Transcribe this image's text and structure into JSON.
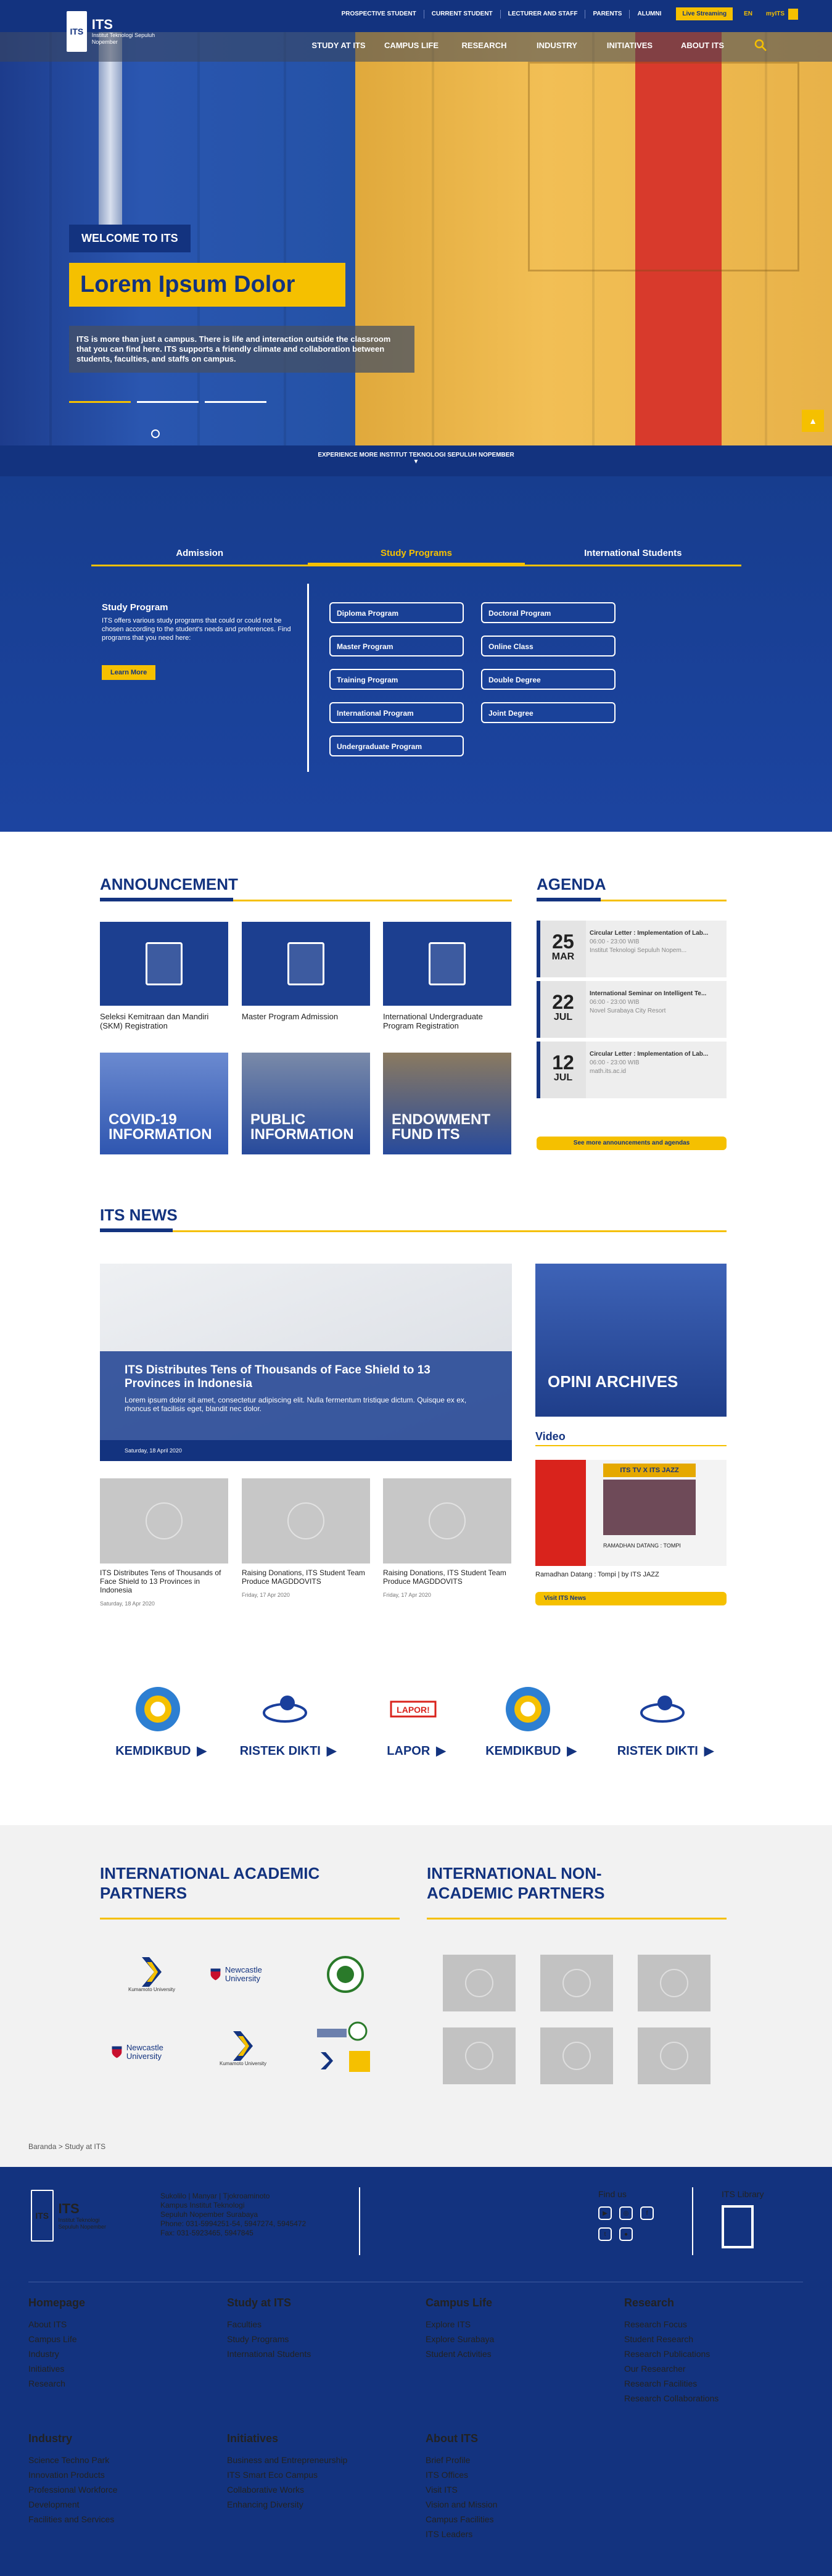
{
  "brand": {
    "logo_name": "ITS",
    "logo_sub": "Institut Teknologi Sepuluh Nopember"
  },
  "topbar": {
    "links": [
      "PROSPECTIVE STUDENT",
      "CURRENT STUDENT",
      "LECTURER AND STAFF",
      "PARENTS",
      "ALUMNI"
    ],
    "live": "Live Streaming",
    "lang": "EN",
    "myits": "myITS"
  },
  "nav": [
    "STUDY AT ITS",
    "CAMPUS LIFE",
    "RESEARCH",
    "INDUSTRY",
    "INITIATIVES",
    "ABOUT ITS"
  ],
  "hero": {
    "welcome": "WELCOME TO ITS",
    "title": "Lorem Ipsum Dolor",
    "desc": "ITS is more than just a campus. There is life and interaction outside the classroom that you can find here. ITS supports a friendly climate and collaboration between students, faculties, and staffs on campus.",
    "experience": "EXPERIENCE MORE INSTITUT TEKNOLOGI SEPULUH NOPEMBER"
  },
  "programs": {
    "tabs": [
      "Admission",
      "Study Programs",
      "International Students"
    ],
    "active_tab": 1,
    "heading": "Study Program",
    "text": "ITS offers various study programs that could or could not be chosen according to the student's needs and preferences. Find programs that you need here:",
    "learn_more": "Learn More",
    "buttons_left": [
      "Diploma Program",
      "Master Program",
      "Training Program",
      "International Program",
      "Undergraduate Program"
    ],
    "buttons_right": [
      "Doctoral Program",
      "Online Class",
      "Double Degree",
      "Joint Degree"
    ]
  },
  "announcement": {
    "title": "ANNOUNCEMENT",
    "items": [
      "Seleksi Kemitraan dan Mandiri (SKM) Registration",
      "Master Program Admission",
      "International Undergraduate Program Registration"
    ],
    "info": [
      "COVID-19 INFORMATION",
      "PUBLIC INFORMATION",
      "ENDOWMENT FUND ITS"
    ]
  },
  "agenda": {
    "title": "AGENDA",
    "items": [
      {
        "day": "25",
        "month": "MAR",
        "title": "Circular Letter : Implementation of Lab...",
        "time": "06:00 - 23:00 WIB",
        "place": "Institut Teknologi Sepuluh Nopem..."
      },
      {
        "day": "22",
        "month": "JUL",
        "title": "International Seminar on Intelligent Te...",
        "time": "06:00 - 23:00 WIB",
        "place": "Novel Surabaya City Resort"
      },
      {
        "day": "12",
        "month": "JUL",
        "title": "Circular Letter : Implementation of Lab...",
        "time": "06:00 - 23:00 WIB",
        "place": "math.its.ac.id"
      }
    ],
    "more": "See more announcements and agendas"
  },
  "news": {
    "title": "ITS NEWS",
    "main_title": "ITS Distributes Tens of Thousands of Face Shield to 13 Provinces in Indonesia",
    "main_text": "Lorem ipsum dolor sit amet, consectetur adipiscing elit. Nulla fermentum tristique dictum. Quisque ex ex, rhoncus et facilisis eget, blandit nec dolor.",
    "main_date": "Saturday, 18 April 2020",
    "items": [
      {
        "title": "ITS Distributes Tens of Thousands of Face Shield to 13 Provinces in Indonesia",
        "date": "Saturday, 18 Apr 2020"
      },
      {
        "title": "Raising Donations, ITS Student Team Produce MAGDDOVITS",
        "date": "Friday, 17 Apr 2020"
      },
      {
        "title": "Raising Donations, ITS Student Team Produce MAGDDOVITS",
        "date": "Friday, 17 Apr 2020"
      }
    ],
    "opini": "OPINI ARCHIVES",
    "video_title": "Video",
    "video_banner": "ITS TV X ITS JAZZ",
    "video_screen_cap": "RAMADHAN DATANG : TOMPI",
    "video_caption": "Ramadhan Datang : Tompi | by ITS JAZZ",
    "visit_news": "Visit ITS News"
  },
  "ministries": [
    "KEMDIKBUD",
    "RISTEK DIKTI",
    "LAPOR",
    "KEMDIKBUD",
    "RISTEK DIKTI"
  ],
  "partners": {
    "academic_title": "INTERNATIONAL ACADEMIC PARTNERS",
    "nonacademic_title": "INTERNATIONAL NON-ACADEMIC PARTNERS",
    "academic_logos": [
      "Kumamoto University",
      "Newcastle University",
      "Newcastle University",
      "Kumamoto University"
    ]
  },
  "breadcrumb": "Baranda > Study at ITS",
  "footer": {
    "contact": [
      "Sukolilo | Manyar | Tjokroaminoto",
      "Kampus Institut Teknologi",
      "Sepuluh Nopember Surabaya",
      "Phone: 031-5994251-54, 5947274, 5945472",
      "Fax: 031-5923465, 5947845"
    ],
    "findus": "Find us",
    "library": "ITS Library",
    "columns": [
      {
        "title": "Homepage",
        "links": [
          "About ITS",
          "Campus Life",
          "Industry",
          "Initiatives",
          "Research"
        ]
      },
      {
        "title": "Study at ITS",
        "links": [
          "Faculties",
          "Study Programs",
          "International Students"
        ]
      },
      {
        "title": "Campus Life",
        "links": [
          "Explore ITS",
          "Explore Surabaya",
          "Student Activities"
        ]
      },
      {
        "title": "Research",
        "links": [
          "Research Focus",
          "Student Research",
          "Research Publications",
          "Our Researcher",
          "Research Facilities",
          "Research Collaborations"
        ]
      },
      {
        "title": "Industry",
        "links": [
          "Science Techno Park",
          "Innovation Products",
          "Professional Workforce Development",
          "Facilities and Services"
        ]
      },
      {
        "title": "Initiatives",
        "links": [
          "Business and Entrepreneurship",
          "ITS Smart Eco Campus",
          "Collaborative Works",
          "Enhancing Diversity"
        ]
      },
      {
        "title": "About ITS",
        "links": [
          "Brief Profile",
          "ITS Offices",
          "Visit ITS",
          "Vision and Mission",
          "Campus Facilities",
          "ITS Leaders"
        ]
      }
    ]
  },
  "colors": {
    "primary": "#13337f",
    "accent": "#f5c000"
  }
}
